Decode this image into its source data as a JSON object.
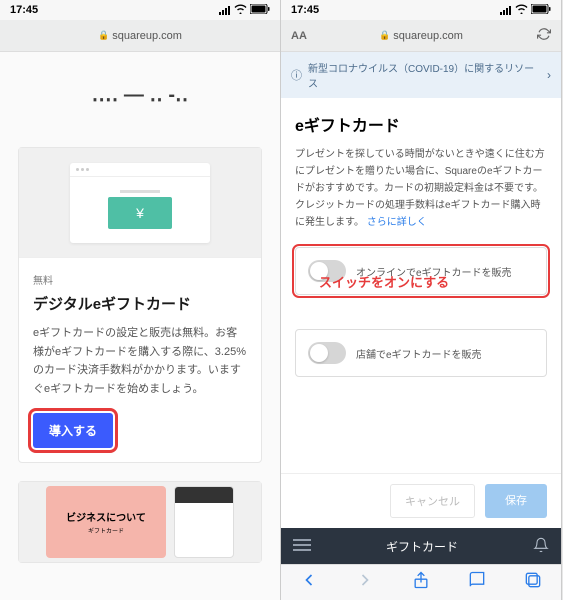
{
  "status": {
    "time": "17:45"
  },
  "address": {
    "domain": "squareup.com",
    "aa": "AA"
  },
  "left": {
    "truncated_title": "‥‥ — ‥ ‐‥",
    "card1": {
      "badge": "無料",
      "title": "デジタルeギフトカード",
      "desc": "eギフトカードの設定と販売は無料。お客様がeギフトカードを購入する際に、3.25%のカード決済手数料がかかります。いますぐeギフトカードを始めましょう。",
      "cta": "導入する"
    },
    "card2": {
      "title": "ビジネスについて",
      "sub": "ギフトカード"
    }
  },
  "right": {
    "banner": "新型コロナウイルス（COVID-19）に関するリソース",
    "title": "eギフトカード",
    "desc": "プレゼントを探している時間がないときや遠くに住む方にプレゼントを贈りたい場合に、Squareのeギフトカードがおすすめです。カードの初期設定料金は不要です。クレジットカードの処理手数料はeギフトカード購入時に発生します。",
    "link": "さらに詳しく",
    "toggle1": "オンラインでeギフトカードを販売",
    "toggle2": "店舗でeギフトカードを販売",
    "callout": "スイッチをオンにする",
    "cancel": "キャンセル",
    "save": "保存",
    "footer_title": "ギフトカード"
  }
}
